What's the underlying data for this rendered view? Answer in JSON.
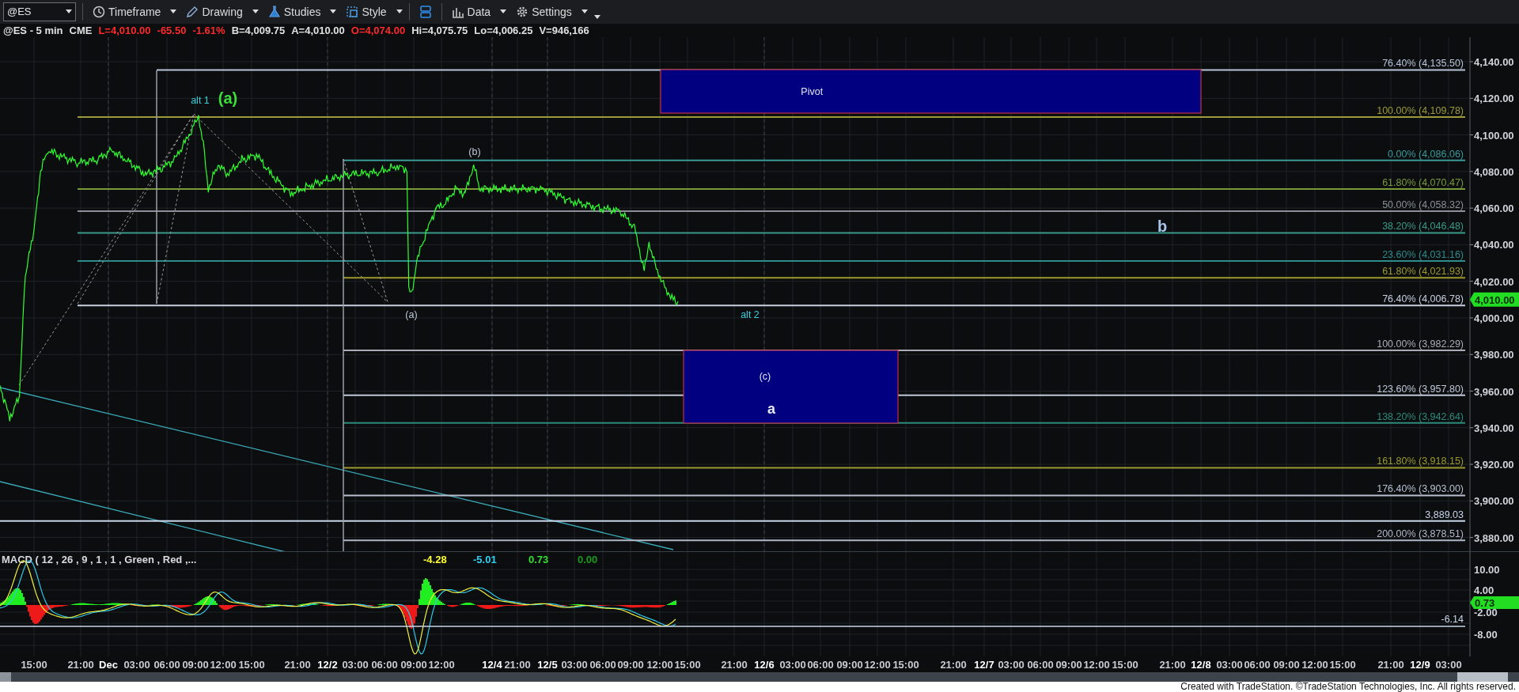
{
  "toolbar": {
    "symbol": "@ES",
    "buttons": [
      {
        "label": "Timeframe",
        "kind": "clock"
      },
      {
        "label": "Drawing",
        "kind": "pen"
      },
      {
        "label": "Studies",
        "kind": "flask"
      },
      {
        "label": "Style",
        "kind": "frame"
      },
      {
        "kind": "layout"
      },
      {
        "label": "Data",
        "kind": "bars"
      },
      {
        "label": "Settings",
        "kind": "gear"
      }
    ]
  },
  "quote": [
    {
      "text": "@ES - 5 min",
      "color": "#e0e0e0"
    },
    {
      "text": "CME",
      "color": "#e0e0e0"
    },
    {
      "text": "L=4,010.00",
      "color": "#ff2a2a"
    },
    {
      "text": "-65.50",
      "color": "#ff2a2a"
    },
    {
      "text": "-1.61%",
      "color": "#ff2a2a"
    },
    {
      "text": "B=4,009.75",
      "color": "#e0e0e0"
    },
    {
      "text": "A=4,010.00",
      "color": "#e0e0e0"
    },
    {
      "text": "O=4,074.00",
      "color": "#ff2a2a"
    },
    {
      "text": "Hi=4,075.75",
      "color": "#e0e0e0"
    },
    {
      "text": "Lo=4,006.25",
      "color": "#e0e0e0"
    },
    {
      "text": "V=946,166",
      "color": "#e0e0e0"
    }
  ],
  "price_axis": {
    "ticks": [
      "4,140.00",
      "4,120.00",
      "4,100.00",
      "4,080.00",
      "4,060.00",
      "4,040.00",
      "4,020.00",
      "4,000.00",
      "3,980.00",
      "3,960.00",
      "3,940.00",
      "3,920.00",
      "3,900.00",
      "3,880.00"
    ],
    "last": "4,010.00"
  },
  "fib_levels": [
    {
      "label": "76.40% (4,135.50)",
      "color": "#b8c4d8"
    },
    {
      "label": "100.00% (4,109.78)",
      "color": "#9c9a3a"
    },
    {
      "label": "0.00% (4,086.06)",
      "color": "#3a9a9a"
    },
    {
      "label": "61.80% (4,070.47)",
      "color": "#7a9a3a"
    },
    {
      "label": "50.00% (4,058.32)",
      "color": "#8a8f99"
    },
    {
      "label": "38.20% (4,046.48)",
      "color": "#3a9a8a"
    },
    {
      "label": "23.60% (4,031.16)",
      "color": "#2e8b8b"
    },
    {
      "label": "61.80% (4,021.93)",
      "color": "#9c9a2e"
    },
    {
      "label": "76.40% (4,006.78)",
      "color": "#c8d0e0"
    },
    {
      "label": "100.00% (3,982.29)",
      "color": "#a8adb8"
    },
    {
      "label": "123.60% (3,957.80)",
      "color": "#c0c8d8"
    },
    {
      "label": "138.20% (3,942.64)",
      "color": "#2e8b7b"
    },
    {
      "label": "161.80% (3,918.15)",
      "color": "#9c9a2e"
    },
    {
      "label": "176.40% (3,903.00)",
      "color": "#b8c0d0"
    },
    {
      "label": "3,889.03",
      "color": "#c8d4e8"
    },
    {
      "label": "200.00% (3,878.51)",
      "color": "#b0b8c8"
    }
  ],
  "annotations": [
    {
      "text": "alt 1",
      "color": "#3ad0e0",
      "kind": "small"
    },
    {
      "text": "(a)",
      "color": "#3adf3a",
      "kind": "large"
    },
    {
      "text": "(b)",
      "color": "#c0c8d8",
      "kind": "small"
    },
    {
      "text": "(a)",
      "color": "#c0c8d8",
      "kind": "small"
    },
    {
      "text": "alt 2",
      "color": "#3ad0e0",
      "kind": "small"
    },
    {
      "text": "b",
      "color": "#a8c4e8",
      "kind": "large"
    }
  ],
  "zones": [
    {
      "label": "Pivot"
    },
    {
      "label": "(c)",
      "sublabel": "a"
    }
  ],
  "macd": {
    "title": "MACD ( 12 , 26 , 9 , 1 , 1 , Green , Red ,...",
    "values": [
      {
        "text": "-4.28",
        "color": "#ffff30"
      },
      {
        "text": "-5.01",
        "color": "#30d0f0"
      },
      {
        "text": "0.73",
        "color": "#30e030"
      },
      {
        "text": "0.00",
        "color": "#1a9a1a"
      }
    ],
    "ticks": [
      "10.00",
      "4.00",
      "-2.00",
      "-8.00"
    ],
    "last": "0.73",
    "line_label": "-6.14"
  },
  "time_axis": [
    {
      "text": "15:00",
      "kind": "time"
    },
    {
      "text": "21:00",
      "kind": "time"
    },
    {
      "text": "Dec",
      "kind": "date"
    },
    {
      "text": "03:00",
      "kind": "time"
    },
    {
      "text": "06:00",
      "kind": "time"
    },
    {
      "text": "09:00",
      "kind": "time"
    },
    {
      "text": "12:00",
      "kind": "time"
    },
    {
      "text": "15:00",
      "kind": "time"
    },
    {
      "text": "21:00",
      "kind": "time"
    },
    {
      "text": "12/2",
      "kind": "date"
    },
    {
      "text": "03:00",
      "kind": "time"
    },
    {
      "text": "06:00",
      "kind": "time"
    },
    {
      "text": "09:00",
      "kind": "time"
    },
    {
      "text": "12:00",
      "kind": "time"
    },
    {
      "text": "12/4",
      "kind": "date"
    },
    {
      "text": "21:00",
      "kind": "time"
    },
    {
      "text": "12/5",
      "kind": "date"
    },
    {
      "text": "03:00",
      "kind": "time"
    },
    {
      "text": "06:00",
      "kind": "time"
    },
    {
      "text": "09:00",
      "kind": "time"
    },
    {
      "text": "12:00",
      "kind": "time"
    },
    {
      "text": "15:00",
      "kind": "time"
    },
    {
      "text": "21:00",
      "kind": "time"
    },
    {
      "text": "12/6",
      "kind": "date"
    },
    {
      "text": "03:00",
      "kind": "time"
    },
    {
      "text": "06:00",
      "kind": "time"
    },
    {
      "text": "09:00",
      "kind": "time"
    },
    {
      "text": "12:00",
      "kind": "time"
    },
    {
      "text": "15:00",
      "kind": "time"
    },
    {
      "text": "21:00",
      "kind": "time"
    },
    {
      "text": "12/7",
      "kind": "date"
    },
    {
      "text": "03:00",
      "kind": "time"
    },
    {
      "text": "06:00",
      "kind": "time"
    },
    {
      "text": "09:00",
      "kind": "time"
    },
    {
      "text": "12:00",
      "kind": "time"
    },
    {
      "text": "15:00",
      "kind": "time"
    },
    {
      "text": "21:00",
      "kind": "time"
    },
    {
      "text": "12/8",
      "kind": "date"
    },
    {
      "text": "03:00",
      "kind": "time"
    },
    {
      "text": "06:00",
      "kind": "time"
    },
    {
      "text": "09:00",
      "kind": "time"
    },
    {
      "text": "12:00",
      "kind": "time"
    },
    {
      "text": "15:00",
      "kind": "time"
    },
    {
      "text": "21:00",
      "kind": "time"
    },
    {
      "text": "12/9",
      "kind": "date"
    },
    {
      "text": "03:00",
      "kind": "time"
    }
  ],
  "footer": "Created with TradeStation. ©TradeStation Technologies, Inc. All rights reserved."
}
